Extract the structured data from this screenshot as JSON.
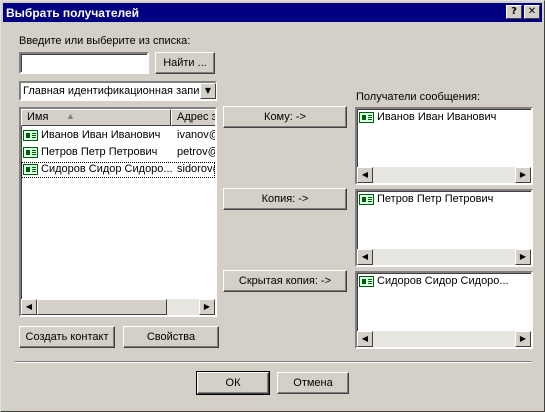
{
  "dialog": {
    "title": "Выбрать получателей",
    "help_btn": "?",
    "close_btn": "✕"
  },
  "search": {
    "label": "Введите или выберите из списка:",
    "value": "",
    "find_button": "Найти ..."
  },
  "address_book": {
    "selected": "Главная идентификационная запись"
  },
  "contacts_table": {
    "columns": [
      "Имя",
      "Адрес э"
    ],
    "rows": [
      {
        "name": "Иванов Иван Иванович",
        "email": "ivanov@"
      },
      {
        "name": "Петров Петр Петрович",
        "email": "petrov@"
      },
      {
        "name": "Сидоров Сидор Сидоро...",
        "email": "sidorov@"
      }
    ]
  },
  "buttons": {
    "to": "Кому: ->",
    "cc": "Копия: ->",
    "bcc": "Скрытая копия: ->",
    "new_contact": "Создать контакт",
    "properties": "Свойства",
    "ok": "ОК",
    "cancel": "Отмена"
  },
  "recipients": {
    "label": "Получатели сообщения:",
    "to_list": [
      "Иванов Иван Иванович"
    ],
    "cc_list": [
      "Петров Петр Петрович"
    ],
    "bcc_list": [
      "Сидоров Сидор Сидоро..."
    ]
  },
  "icons": {
    "contact": "contact-card-icon",
    "sort": "sort-ascending-icon",
    "scroll_left": "arrow-left-icon",
    "scroll_right": "arrow-right-icon",
    "dropdown": "chevron-down-icon"
  },
  "colors": {
    "titlebar": "#000080",
    "face": "#d4d0c8",
    "window": "#ffffff"
  }
}
